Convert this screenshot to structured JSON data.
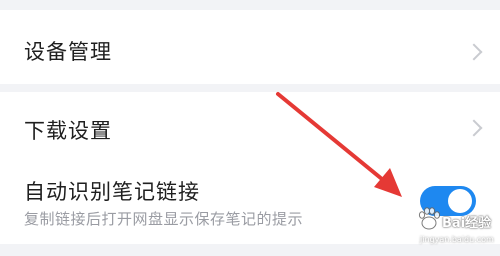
{
  "settings": {
    "device_management": {
      "label": "设备管理"
    },
    "download_settings": {
      "label": "下载设置"
    },
    "auto_link": {
      "label": "自动识别笔记链接",
      "description": "复制链接后打开网盘显示保存笔记的提示",
      "enabled": true
    }
  },
  "colors": {
    "toggle_on": "#1e88f0",
    "arrow": "#e53935",
    "background": "#f2f3f6"
  },
  "watermark": {
    "text": "Bai经验",
    "url": "jingyan.baidu.com"
  },
  "icons": {
    "chevron": "chevron-right-icon",
    "annotation": "red-arrow-icon",
    "watermark": "baidu-paw-logo"
  }
}
